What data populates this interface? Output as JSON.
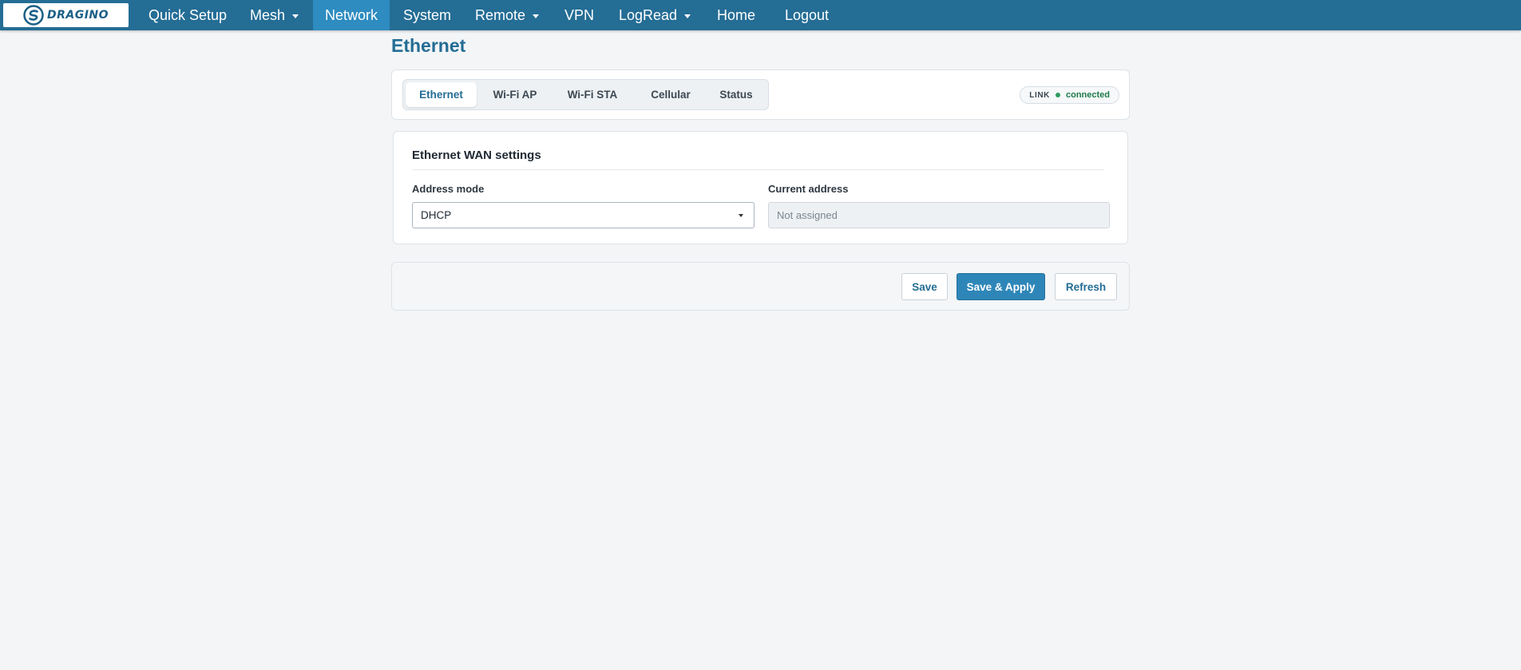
{
  "brand": {
    "logo_text": "DRAGINO",
    "accent_color": "#246d95",
    "active_color": "#2e8cc0"
  },
  "nav": {
    "items": [
      {
        "label": "Quick Setup",
        "has_dropdown": false
      },
      {
        "label": "Mesh",
        "has_dropdown": true
      },
      {
        "label": "Network",
        "has_dropdown": false,
        "active": true
      },
      {
        "label": "System",
        "has_dropdown": false
      },
      {
        "label": "Remote",
        "has_dropdown": true
      },
      {
        "label": "VPN",
        "has_dropdown": false
      },
      {
        "label": "LogRead",
        "has_dropdown": true
      },
      {
        "label": "Home",
        "has_dropdown": false
      },
      {
        "label": "Logout",
        "has_dropdown": false
      }
    ]
  },
  "page": {
    "title": "Ethernet"
  },
  "tabs": {
    "items": [
      {
        "label": "Ethernet",
        "active": true
      },
      {
        "label": "Wi-Fi AP"
      },
      {
        "label": "Wi-Fi STA"
      },
      {
        "label": "Cellular"
      },
      {
        "label": "Status"
      }
    ]
  },
  "link_status": {
    "label": "LINK",
    "value": "connected",
    "color": "#2e9b5f"
  },
  "settings": {
    "title": "Ethernet WAN settings",
    "address_mode": {
      "label": "Address mode",
      "value": "DHCP"
    },
    "current_address": {
      "label": "Current address",
      "placeholder": "Not assigned"
    }
  },
  "actions": {
    "save": "Save",
    "save_apply": "Save & Apply",
    "refresh": "Refresh"
  }
}
